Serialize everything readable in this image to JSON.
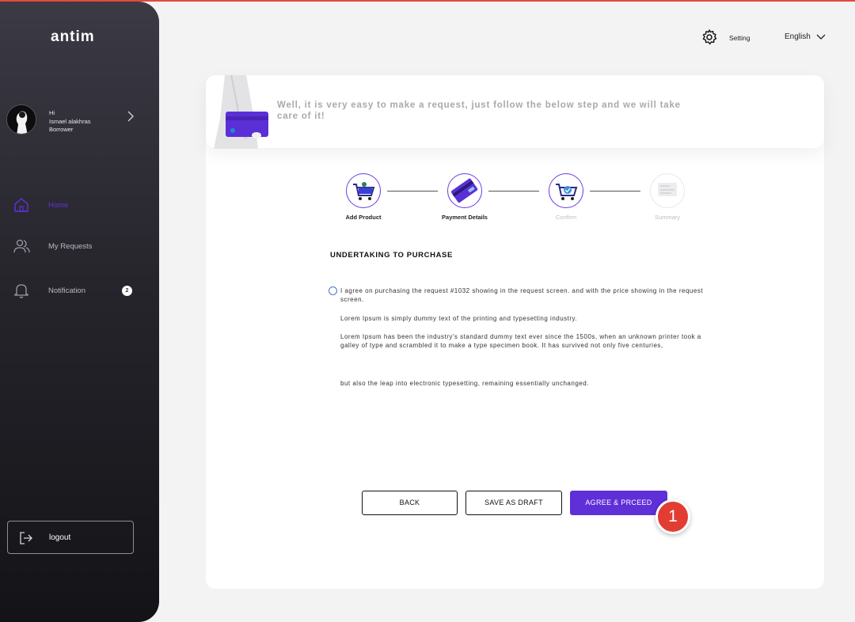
{
  "app": {
    "logo": "antim"
  },
  "profile": {
    "greeting": "Hi",
    "name": "Ismael alakhras",
    "role": "Borrower"
  },
  "sidebar": {
    "items": [
      {
        "label": "Home",
        "icon": "home-icon",
        "active": true
      },
      {
        "label": "My Requests",
        "icon": "users-icon",
        "active": false
      },
      {
        "label": "Notification",
        "icon": "bell-icon",
        "active": false,
        "badge": "2"
      }
    ],
    "logout_label": "logout"
  },
  "header": {
    "setting_label": "Setting",
    "language": "English"
  },
  "banner": {
    "text": "Well, it is very easy to make a request, just follow the below step and we will take care of it!"
  },
  "steps": [
    {
      "label": "Add Product",
      "state": "done"
    },
    {
      "label": "Payment Details",
      "state": "done"
    },
    {
      "label": "Confirm",
      "state": "current"
    },
    {
      "label": "Summary",
      "state": "pending"
    }
  ],
  "content": {
    "title": "UNDERTAKING TO PURCHASE",
    "agree_text": "I agree on purchasing the request #1032 showing in the request screen. and with the price showing in the request screen.",
    "para1": "Lorem Ipsum is simply dummy text of the printing and typesetting industry.",
    "para2": "Lorem Ipsum has been the industry's standard dummy text ever since the 1500s, when an unknown printer took a galley of type and scrambled it to make a type specimen book. It has survived not only five centuries,",
    "para3": "but also the leap into electronic typesetting, remaining essentially unchanged."
  },
  "buttons": {
    "back": "BACK",
    "save_draft": "SAVE AS DRAFT",
    "agree": "AGREE & PRCEED"
  },
  "annotation": {
    "marker": "1"
  },
  "colors": {
    "accent": "#5f2fd8",
    "marker": "#e23d33",
    "sidebar": "#2a2930"
  }
}
